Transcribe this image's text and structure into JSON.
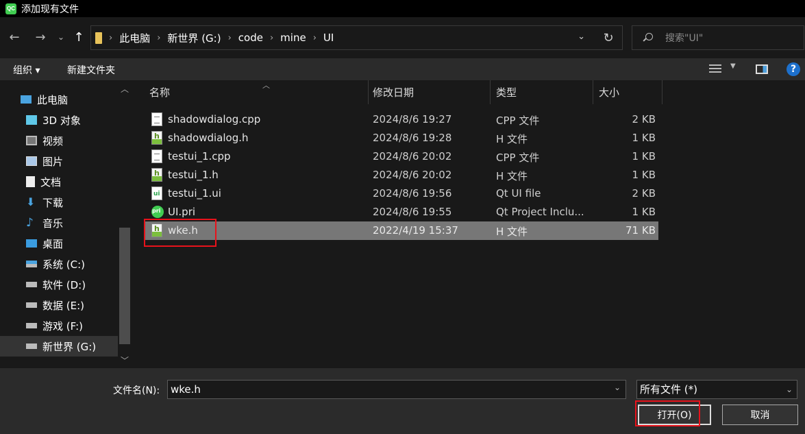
{
  "window": {
    "title": "添加现有文件",
    "app_icon": "QC"
  },
  "navigation": {
    "back_icon": "←",
    "forward_icon": "→",
    "recent_icon": "⌄",
    "up_icon": "↑",
    "breadcrumbs": [
      "此电脑",
      "新世界 (G:)",
      "code",
      "mine",
      "UI"
    ],
    "search_placeholder": "搜索\"UI\""
  },
  "toolbar": {
    "organize_label": "组织 ▾",
    "new_folder_label": "新建文件夹",
    "help_label": "?"
  },
  "sidebar": {
    "items": [
      {
        "label": "此电脑",
        "icon": "computer-icon"
      },
      {
        "label": "3D 对象",
        "icon": "cube-icon"
      },
      {
        "label": "视频",
        "icon": "video-icon"
      },
      {
        "label": "图片",
        "icon": "picture-icon"
      },
      {
        "label": "文档",
        "icon": "document-icon"
      },
      {
        "label": "下载",
        "icon": "download-icon"
      },
      {
        "label": "音乐",
        "icon": "music-icon"
      },
      {
        "label": "桌面",
        "icon": "desktop-icon"
      },
      {
        "label": "系统 (C:)",
        "icon": "drive-icon"
      },
      {
        "label": "软件 (D:)",
        "icon": "drive-icon"
      },
      {
        "label": "数据 (E:)",
        "icon": "drive-icon"
      },
      {
        "label": "游戏 (F:)",
        "icon": "drive-icon"
      },
      {
        "label": "新世界 (G:)",
        "icon": "drive-icon"
      }
    ]
  },
  "columns": {
    "name": "名称",
    "date": "修改日期",
    "type": "类型",
    "size": "大小"
  },
  "files": [
    {
      "name": "shadowdialog.cpp",
      "date": "2024/8/6 19:27",
      "type": "CPP 文件",
      "size": "2 KB",
      "icon": "cpp-file-icon"
    },
    {
      "name": "shadowdialog.h",
      "date": "2024/8/6 19:28",
      "type": "H 文件",
      "size": "1 KB",
      "icon": "header-file-icon"
    },
    {
      "name": "testui_1.cpp",
      "date": "2024/8/6 20:02",
      "type": "CPP 文件",
      "size": "1 KB",
      "icon": "cpp-file-icon"
    },
    {
      "name": "testui_1.h",
      "date": "2024/8/6 20:02",
      "type": "H 文件",
      "size": "1 KB",
      "icon": "header-file-icon"
    },
    {
      "name": "testui_1.ui",
      "date": "2024/8/6 19:56",
      "type": "Qt UI file",
      "size": "2 KB",
      "icon": "qt-ui-file-icon"
    },
    {
      "name": "UI.pri",
      "date": "2024/8/6 19:55",
      "type": "Qt Project Inclu...",
      "size": "1 KB",
      "icon": "qt-pri-file-icon"
    },
    {
      "name": "wke.h",
      "date": "2022/4/19 15:37",
      "type": "H 文件",
      "size": "71 KB",
      "icon": "header-file-icon",
      "selected": true
    }
  ],
  "footer": {
    "filename_label": "文件名(N):",
    "filename_value": "wke.h",
    "filter_value": "所有文件 (*)",
    "open_label": "打开(O)",
    "cancel_label": "取消"
  }
}
